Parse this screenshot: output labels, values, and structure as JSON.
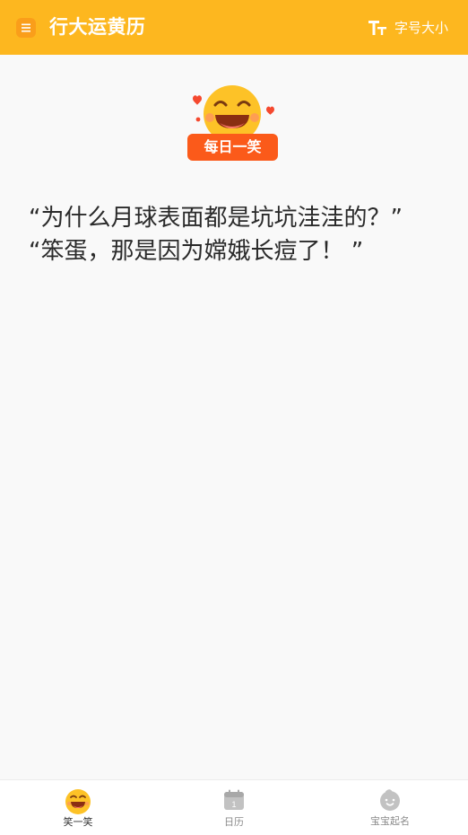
{
  "header": {
    "title": "行大运黄历",
    "font_size_label": "字号大小",
    "menu_icon": "menu-icon",
    "font_icon": "text-size-icon"
  },
  "content": {
    "badge": {
      "label": "每日一笑",
      "icon": "laughing-face-icon"
    },
    "joke_lines": [
      "“为什么月球表面都是坑坑洼洼的？”",
      "“笨蛋，那是因为嫦娥长痘了！ ”"
    ]
  },
  "tabbar": {
    "tabs": [
      {
        "label": "笑一笑",
        "icon": "laughing-face-icon",
        "active": true
      },
      {
        "label": "日历",
        "icon": "calendar-icon",
        "active": false,
        "icon_text": "1"
      },
      {
        "label": "宝宝起名",
        "icon": "baby-face-icon",
        "active": false
      }
    ]
  },
  "colors": {
    "accent": "#fdb71f",
    "badge_red": "#fb5a1a",
    "text": "#2a2a2a",
    "inactive": "#b8b8b8"
  }
}
